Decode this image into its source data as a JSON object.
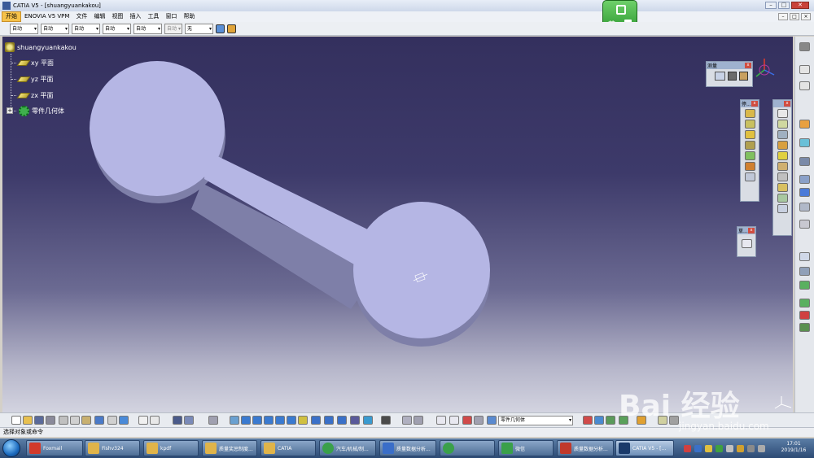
{
  "window": {
    "title": "CATIA V5 - [shuangyuankakou]",
    "buttons": [
      "–",
      "□",
      "✕"
    ]
  },
  "menu": {
    "items": [
      "开始",
      "ENOVIA V5 VPM",
      "文件",
      "编辑",
      "视图",
      "插入",
      "工具",
      "窗口",
      "帮助"
    ],
    "active_index": 0,
    "window_buttons": [
      "–",
      "□",
      "×"
    ]
  },
  "ime": {
    "label": "英"
  },
  "style_toolbar": {
    "combos": [
      "自动",
      "自动",
      "自动",
      "自动",
      "自动",
      "自动",
      "无"
    ]
  },
  "spec_tree": {
    "root": "shuangyuankakou",
    "items": [
      {
        "label": "xy 平面",
        "icon": "plane-icon"
      },
      {
        "label": "yz 平面",
        "icon": "plane-icon"
      },
      {
        "label": "zx 平面",
        "icon": "plane-icon"
      },
      {
        "label": "零件几何体",
        "icon": "part-body-gear-icon"
      }
    ]
  },
  "toolboxes": {
    "measure": {
      "title": "测量"
    },
    "sketch_based": {
      "title": "停..."
    },
    "dress_up": {
      "title": "草..."
    }
  },
  "bottom_toolbar": {
    "current_body": "零件几何体"
  },
  "status": {
    "text": "选择对象或命令"
  },
  "taskbar": {
    "items": [
      {
        "label": "Foxmail",
        "color": "#d23a2a"
      },
      {
        "label": "Fishv324",
        "color": "#e0b44a"
      },
      {
        "label": "kpdf",
        "color": "#e0b44a"
      },
      {
        "label": "质量奖惩制度...",
        "color": "#e0b44a"
      },
      {
        "label": "CATIA",
        "color": "#e0b44a"
      },
      {
        "label": "汽车/机械/制...",
        "color": "#3aa04a"
      },
      {
        "label": "质量数据分析...",
        "color": "#3a6ec8"
      },
      {
        "label": "",
        "color": "#3aa04a"
      },
      {
        "label": "微信",
        "color": "#3aa04a"
      },
      {
        "label": "质量数据分析...",
        "color": "#c0392b"
      },
      {
        "label": "CATIA V5 - [...",
        "color": "#1a3a6a"
      }
    ],
    "clock_time": "17:01",
    "clock_date": "2019/1/16"
  },
  "watermark": {
    "text": "Bai  经验",
    "url": "jingyan.baidu.com"
  },
  "colors": {
    "part_top": "#b5b6e4",
    "part_side": "#7e7fa8",
    "accent": "#f6c24a"
  }
}
